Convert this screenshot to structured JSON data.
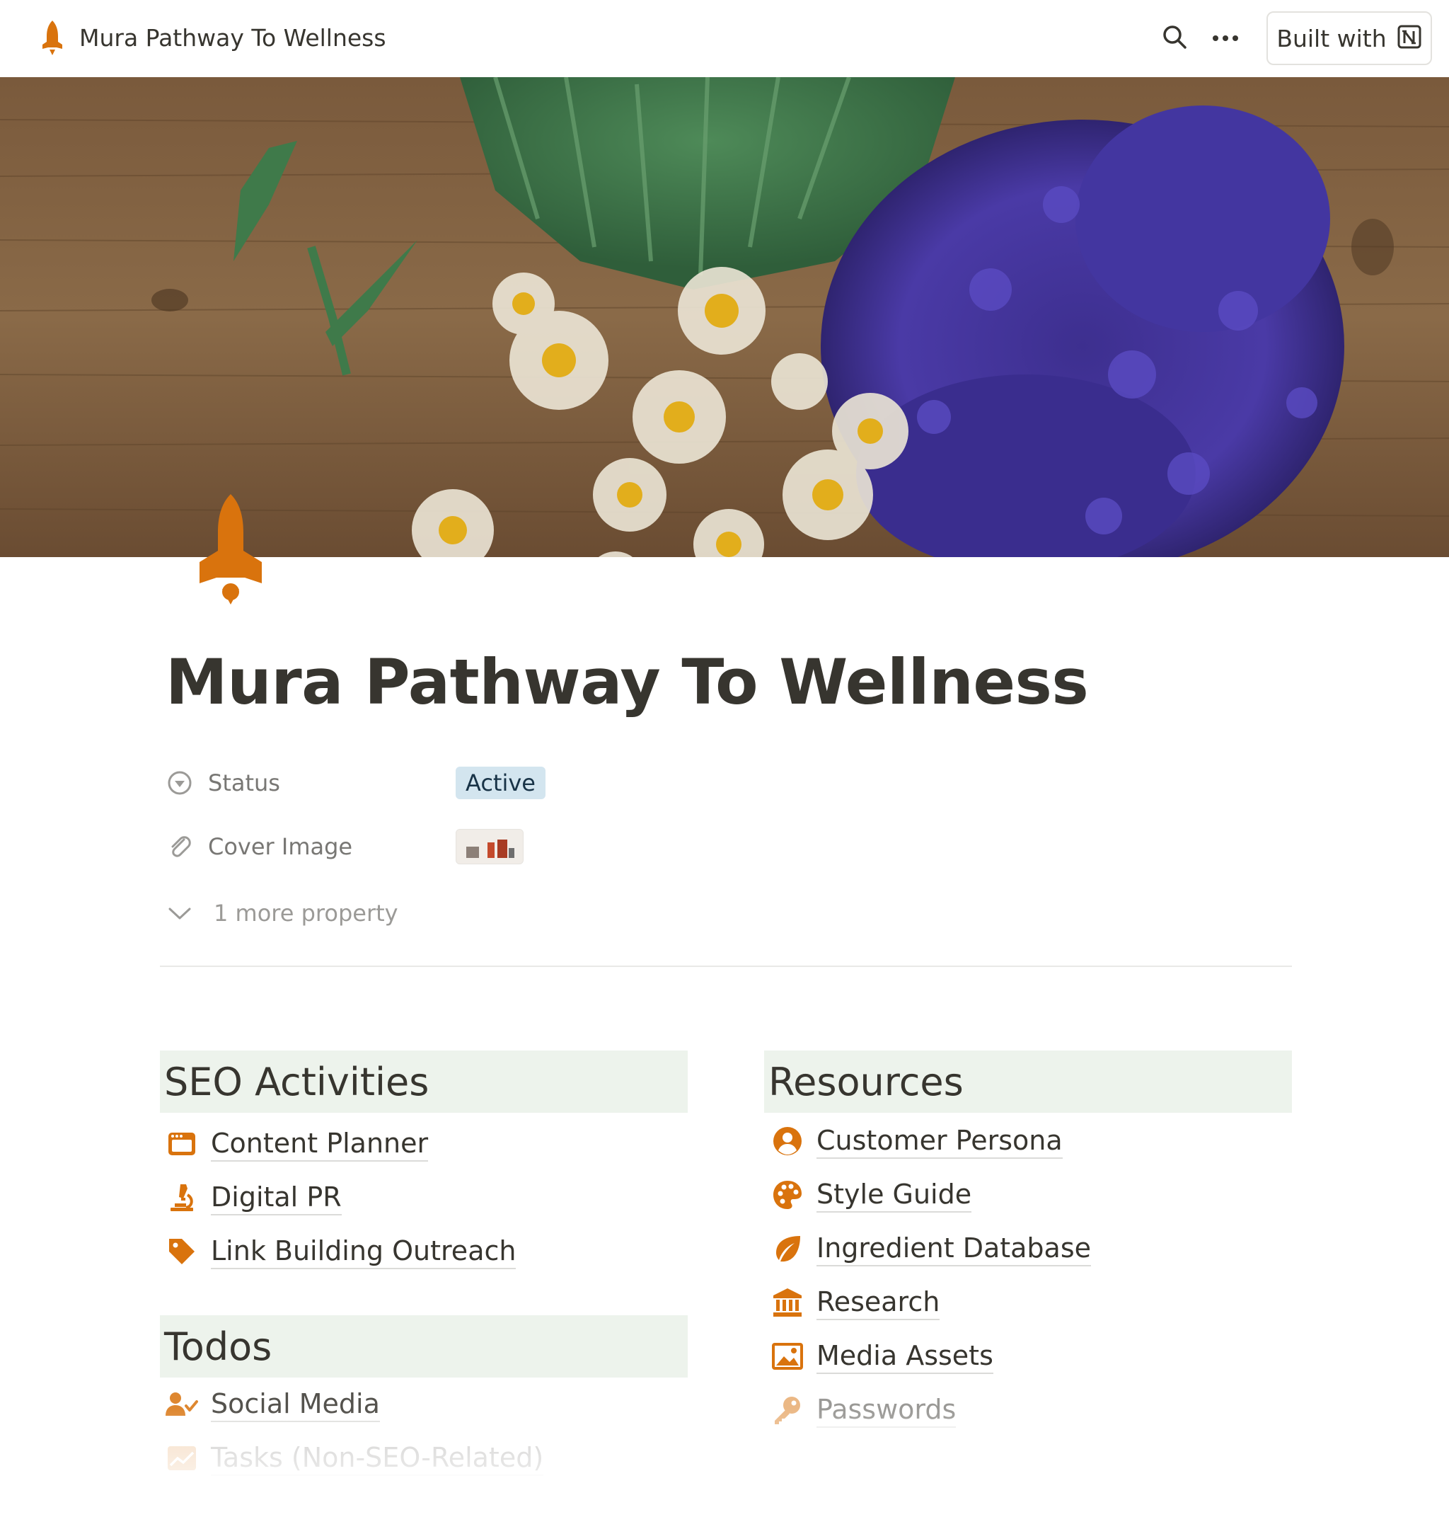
{
  "topbar": {
    "title": "Mura Pathway To Wellness",
    "built_with_label": "Built with",
    "icons": [
      "rocket-icon",
      "search-icon",
      "more-icon",
      "notion-logo-icon"
    ]
  },
  "page": {
    "title": "Mura Pathway To Wellness",
    "accent_color": "#d9730d"
  },
  "properties": {
    "status": {
      "name": "Status",
      "value": "Active",
      "pill_color": "#d3e5ef"
    },
    "cover_image": {
      "name": "Cover Image"
    },
    "more": "1 more property"
  },
  "sections": {
    "seo": {
      "title": "SEO Activities",
      "items": [
        {
          "label": "Content Planner",
          "icon": "calendar-window-icon"
        },
        {
          "label": "Digital PR",
          "icon": "microscope-icon"
        },
        {
          "label": "Link Building Outreach",
          "icon": "tag-icon"
        }
      ]
    },
    "todos": {
      "title": "Todos",
      "items": [
        {
          "label": "Social Media",
          "icon": "user-check-icon"
        },
        {
          "label": "Tasks (Non-SEO-Related)",
          "icon": "chart-icon"
        }
      ]
    },
    "resources": {
      "title": "Resources",
      "items": [
        {
          "label": "Customer Persona",
          "icon": "user-circle-icon"
        },
        {
          "label": "Style Guide",
          "icon": "palette-icon"
        },
        {
          "label": "Ingredient Database",
          "icon": "leaf-icon"
        },
        {
          "label": "Research",
          "icon": "bank-icon"
        },
        {
          "label": "Media Assets",
          "icon": "image-icon"
        },
        {
          "label": "Passwords",
          "icon": "key-icon"
        }
      ]
    }
  }
}
